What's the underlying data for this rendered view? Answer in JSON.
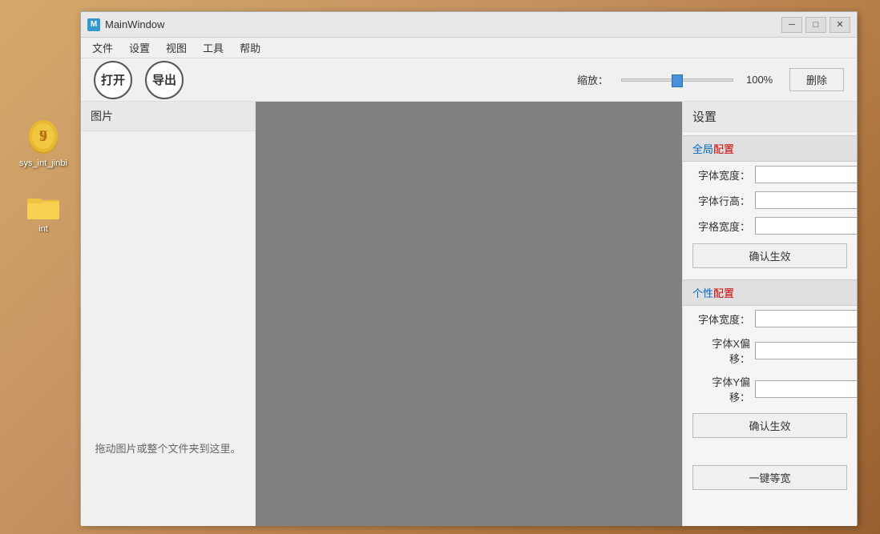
{
  "desktop": {
    "icons": [
      {
        "id": "sys_int_jinbi",
        "label": "sys_int_jinbi",
        "type": "coin"
      },
      {
        "id": "int",
        "label": "int",
        "type": "folder"
      }
    ]
  },
  "window": {
    "title": "MainWindow",
    "icon_label": "M",
    "menu_items": [
      "文件",
      "设置",
      "视图",
      "工具",
      "帮助"
    ],
    "toolbar": {
      "open_label": "打开",
      "export_label": "导出",
      "zoom_label": "缩放：",
      "zoom_percent": "100%",
      "delete_label": "删除"
    },
    "image_panel": {
      "header": "图片",
      "drop_hint": "拖动图片或整个文件夹到这里。"
    },
    "settings_panel": {
      "title": "设置",
      "global_section": "全局配置",
      "global_fields": [
        {
          "label": "字体宽度：",
          "value": ""
        },
        {
          "label": "字体行高：",
          "value": ""
        },
        {
          "label": "字格宽度：",
          "value": ""
        }
      ],
      "global_confirm": "确认生效",
      "personal_section": "个性配置",
      "personal_fields": [
        {
          "label": "字体宽度：",
          "value": ""
        },
        {
          "label": "字体X偏移：",
          "value": ""
        },
        {
          "label": "字体Y偏移：",
          "value": ""
        }
      ],
      "personal_confirm": "确认生效",
      "one_key_btn": "一键等宽"
    }
  }
}
